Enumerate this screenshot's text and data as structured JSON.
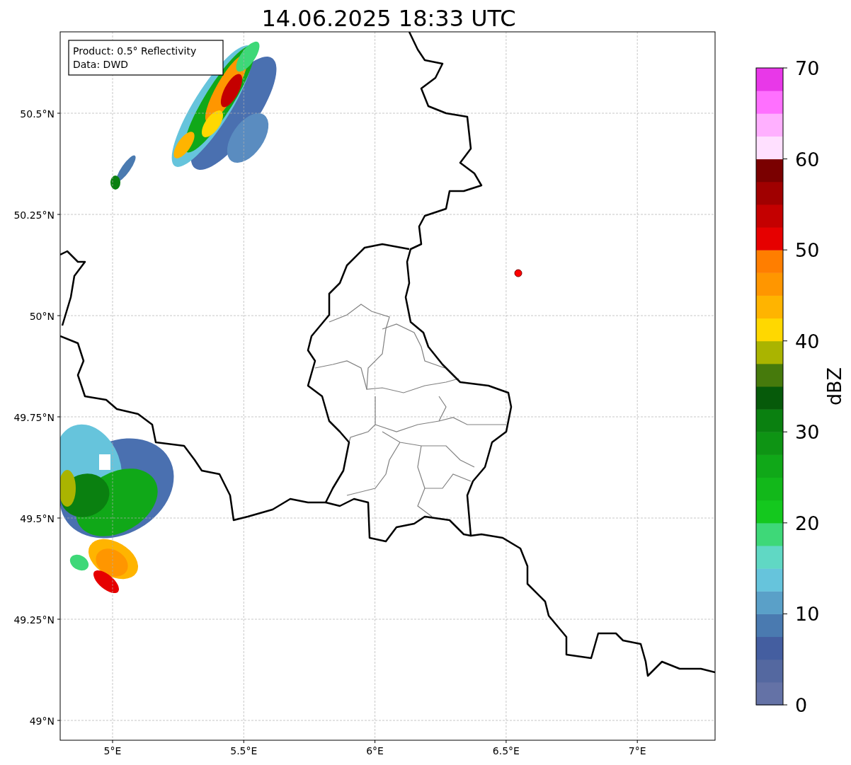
{
  "title": "14.06.2025 18:33 UTC",
  "info_box": {
    "lines": [
      "Product: 0.5° Reflectivity",
      "Data: DWD"
    ]
  },
  "y_ticks": [
    "50.5°N",
    "50.25°N",
    "50°N",
    "49.75°N",
    "49.5°N",
    "49.25°N",
    "49°N"
  ],
  "x_ticks": [
    "5°E",
    "5.5°E",
    "6°E",
    "6.5°E",
    "7°E"
  ],
  "colorbar": {
    "label": "dBZ",
    "ticks": [
      "70",
      "60",
      "50",
      "40",
      "30",
      "20",
      "10",
      "0"
    ],
    "bands": [
      {
        "color": "#6472a6"
      },
      {
        "color": "#5468a0"
      },
      {
        "color": "#445ea0"
      },
      {
        "color": "#4a7ab0"
      },
      {
        "color": "#5aa0c8"
      },
      {
        "color": "#66c4dc"
      },
      {
        "color": "#60d8c4"
      },
      {
        "color": "#3ed878"
      },
      {
        "color": "#14c81e"
      },
      {
        "color": "#12b81a"
      },
      {
        "color": "#10a818"
      },
      {
        "color": "#0e9414"
      },
      {
        "color": "#0a8010"
      },
      {
        "color": "#065a0a"
      },
      {
        "color": "#467a0c"
      },
      {
        "color": "#aab400"
      },
      {
        "color": "#ffd800"
      },
      {
        "color": "#ffb400"
      },
      {
        "color": "#ff9600"
      },
      {
        "color": "#ff7e00"
      },
      {
        "color": "#e60000"
      },
      {
        "color": "#c40000"
      },
      {
        "color": "#a00000"
      },
      {
        "color": "#7a0000"
      },
      {
        "color": "#ffe0ff"
      },
      {
        "color": "#ffb0ff"
      },
      {
        "color": "#ff70ff"
      },
      {
        "color": "#e838e8"
      }
    ]
  }
}
